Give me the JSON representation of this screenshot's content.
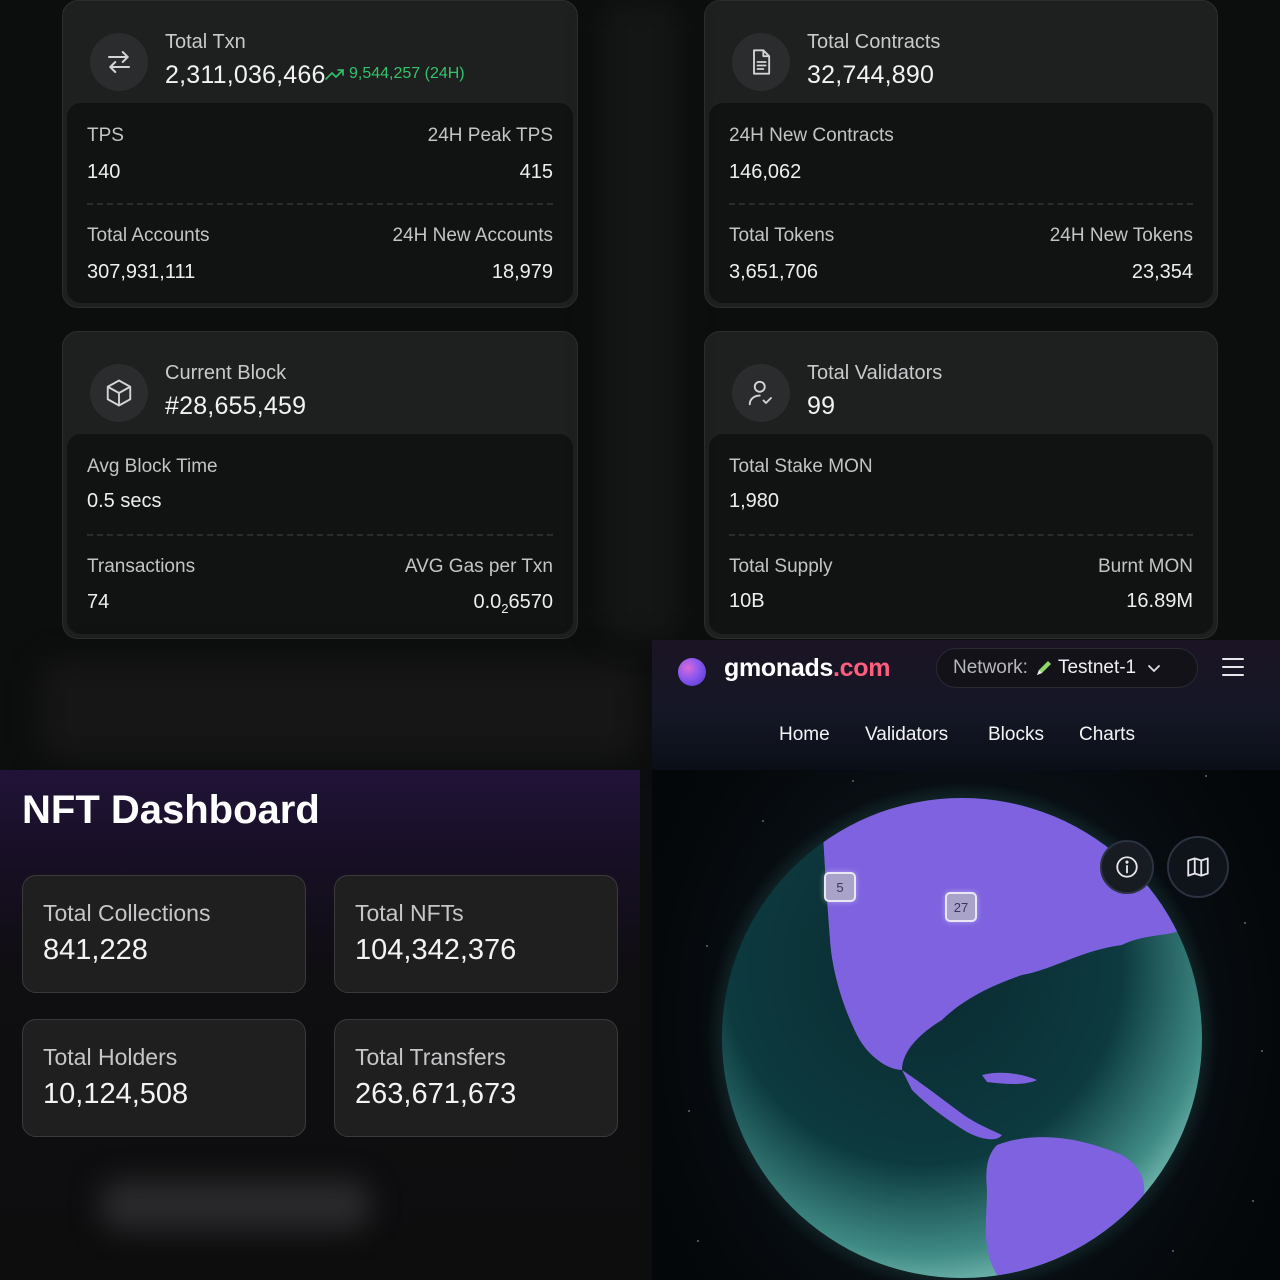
{
  "txn_card": {
    "label": "Total Txn",
    "value": "2,311,036,466",
    "trend": "9,544,257 (24H)",
    "tps_label": "TPS",
    "tps_value": "140",
    "peak_label": "24H Peak TPS",
    "peak_value": "415",
    "accounts_label": "Total Accounts",
    "accounts_value": "307,931,111",
    "new_accounts_label": "24H New Accounts",
    "new_accounts_value": "18,979"
  },
  "contracts_card": {
    "label": "Total Contracts",
    "value": "32,744,890",
    "new_label": "24H New Contracts",
    "new_value": "146,062",
    "tokens_label": "Total Tokens",
    "tokens_value": "3,651,706",
    "new_tokens_label": "24H New Tokens",
    "new_tokens_value": "23,354"
  },
  "block_card": {
    "label": "Current Block",
    "value": "#28,655,459",
    "avg_label": "Avg Block Time",
    "avg_value": "0.5 secs",
    "tx_label": "Transactions",
    "tx_value": "74",
    "gas_label": "AVG Gas per Txn",
    "gas_prefix": "0.0",
    "gas_sub": "2",
    "gas_suffix": "6570"
  },
  "validators_card": {
    "label": "Total Validators",
    "value": "99",
    "stake_label": "Total Stake MON",
    "stake_value": "1,980",
    "supply_label": "Total Supply",
    "supply_value": "10B",
    "burnt_label": "Burnt MON",
    "burnt_value": "16.89M"
  },
  "nft": {
    "title": "NFT Dashboard",
    "cards": [
      {
        "label": "Total Collections",
        "value": "841,228"
      },
      {
        "label": "Total NFTs",
        "value": "104,342,376"
      },
      {
        "label": "Total Holders",
        "value": "10,124,508"
      },
      {
        "label": "Total Transfers",
        "value": "263,671,673"
      }
    ]
  },
  "gmonads": {
    "brand_name": "gmonads",
    "brand_tld": ".com",
    "network_label": "Network:",
    "network_value": "Testnet-1",
    "nav": [
      "Home",
      "Validators",
      "Blocks",
      "Charts"
    ],
    "badges": [
      "5",
      "27"
    ]
  },
  "colors": {
    "trend_green": "#34c36b",
    "brand_accent": "#ff5d7e",
    "land_purple": "#7e62e0",
    "ocean_teal": "#4e9e95",
    "nft_header_purple": "#211338"
  },
  "icons": [
    "transfer-icon",
    "document-icon",
    "cube-icon",
    "user-check-icon",
    "trend-up-icon",
    "info-icon",
    "map-icon",
    "chevron-down-icon",
    "menu-icon",
    "pencil-icon"
  ]
}
